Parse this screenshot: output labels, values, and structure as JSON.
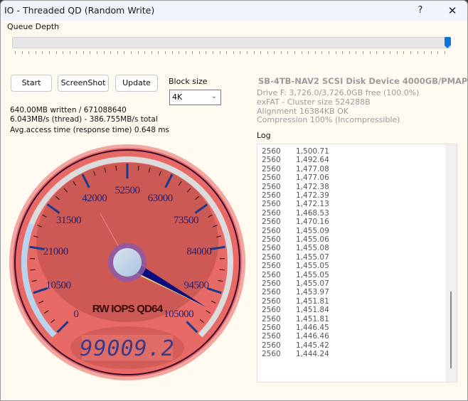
{
  "window": {
    "title": "IO - Threaded QD (Random Write)",
    "help_label": "?",
    "close_label": "✕"
  },
  "queue_depth": {
    "label": "Queue Depth",
    "slider_value_fraction": 1.0,
    "tick_count": 64
  },
  "toolbar": {
    "start_label": "Start",
    "screenshot_label": "ScreenShot",
    "update_label": "Update"
  },
  "block_size": {
    "label": "Block size",
    "selected": "4K",
    "icon": "chevron-down-icon"
  },
  "stats": {
    "written": "640.00MB written / 671088640",
    "throughput": "6.043MB/s (thread) - 386.755MB/s total",
    "access_time": "Avg.access time (response time) 0.648 ms"
  },
  "device": {
    "title": "SB-4TB-NAV2 SCSI Disk Device 4000GB/PMAP",
    "lines": [
      "Drive F: 3,726.0/3,726.0GB free (100.0%)",
      "exFAT - Cluster size 524288B",
      "Alignment 16384KB OK",
      "Compression 100% (Incompressible)"
    ]
  },
  "log": {
    "label": "Log",
    "rows": [
      [
        "2560",
        "1,500.71"
      ],
      [
        "2560",
        "1,492.64"
      ],
      [
        "2560",
        "1,477.08"
      ],
      [
        "2560",
        "1,477.06"
      ],
      [
        "2560",
        "1,472.38"
      ],
      [
        "2560",
        "1,472.39"
      ],
      [
        "2560",
        "1,472.13"
      ],
      [
        "2560",
        "1,468.53"
      ],
      [
        "2560",
        "1,470.16"
      ],
      [
        "2560",
        "1,455.09"
      ],
      [
        "2560",
        "1,455.06"
      ],
      [
        "2560",
        "1,455.08"
      ],
      [
        "2560",
        "1,455.07"
      ],
      [
        "2560",
        "1,455.05"
      ],
      [
        "2560",
        "1,455.05"
      ],
      [
        "2560",
        "1,455.07"
      ],
      [
        "2560",
        "1,453.97"
      ],
      [
        "2560",
        "1,451.81"
      ],
      [
        "2560",
        "1,451.84"
      ],
      [
        "2560",
        "1,451.81"
      ],
      [
        "2560",
        "1,446.45"
      ],
      [
        "2560",
        "1,446.46"
      ],
      [
        "2560",
        "1,445.42"
      ],
      [
        "2560",
        "1,444.24"
      ]
    ]
  },
  "gauge": {
    "title": "RW IOPS QD64",
    "readout": "99009.2",
    "value": 99009.2,
    "min": 0,
    "max": 105000,
    "major_ticks": [
      "0",
      "10500",
      "21000",
      "31500",
      "42000",
      "52500",
      "63000",
      "73500",
      "84000",
      "94500",
      "105000"
    ],
    "minor_per_major": 4,
    "highlight_range": [
      0,
      26000
    ],
    "colors": {
      "face": "#e86a66",
      "face_inner": "#c85652",
      "rim_dark": "#3a0a30",
      "ring": "#dcdcdc",
      "highlight": "#b8d4ee",
      "tick_major": "#1c3a8a",
      "label": "#2a1f6a",
      "needle": "#0c0c80",
      "needle_shadow": "#e8e070",
      "hub": "#c6d8ea",
      "hub_ring": "#8a5aa8",
      "digits": "#3a3a8a"
    }
  }
}
